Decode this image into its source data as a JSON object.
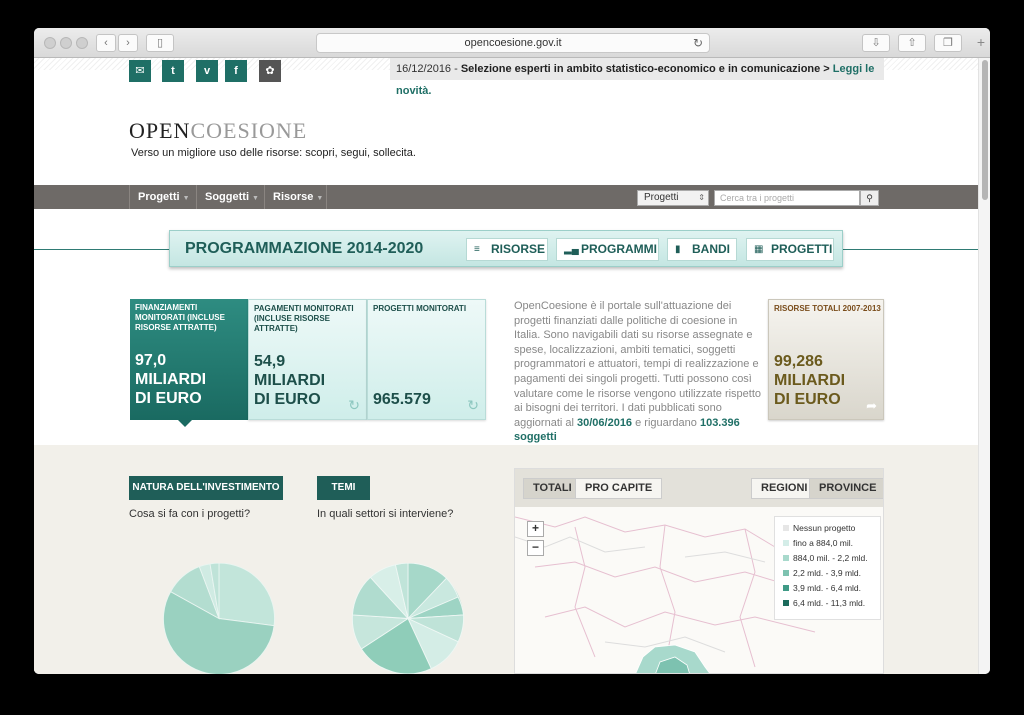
{
  "browser": {
    "url": "opencoesione.gov.it"
  },
  "header": {
    "social_icons": [
      "mail-icon",
      "twitter-icon",
      "vimeo-icon",
      "facebook-icon",
      "award-icon"
    ],
    "notice_date": "16/12/2016 - ",
    "notice_text": "Selezione esperti in ambito statistico-economico e in comunicazione > ",
    "notice_link": "Leggi le novità.",
    "logo_part1": "OPEN",
    "logo_part2": "COESIONE",
    "tagline": "Verso un migliore uso delle risorse: scopri, segui, sollecita."
  },
  "nav": {
    "items": [
      {
        "label": "Progetti"
      },
      {
        "label": "Soggetti"
      },
      {
        "label": "Risorse"
      }
    ],
    "select_value": "Progetti",
    "search_placeholder": "Cerca tra i progetti"
  },
  "programmazione": {
    "title": "PROGRAMMAZIONE 2014-2020",
    "buttons": [
      {
        "label": "RISORSE",
        "icon": "stack-icon"
      },
      {
        "label": "PROGRAMMI",
        "icon": "bar-chart-icon"
      },
      {
        "label": "BANDI",
        "icon": "bookmark-icon"
      },
      {
        "label": "PROGETTI",
        "icon": "document-icon"
      }
    ]
  },
  "stats": {
    "finanziamenti": {
      "label": "FINANZIAMENTI MONITORATI (INCLUSE RISORSE ATTRATTE)",
      "value_lines": [
        "97,0",
        "MILIARDI",
        "DI EURO"
      ]
    },
    "pagamenti": {
      "label": "PAGAMENTI MONITORATI (INCLUSE RISORSE ATTRATTE)",
      "value_lines": [
        "54,9",
        "MILIARDI",
        "DI EURO"
      ]
    },
    "progetti": {
      "label": "PROGETTI MONITORATI",
      "value": "965.579"
    },
    "risorse_totali": {
      "label": "RISORSE TOTALI 2007-2013",
      "value_lines": [
        "99,286",
        "MILIARDI",
        "DI EURO"
      ]
    }
  },
  "description": {
    "text": "OpenCoesione è il portale sull'attuazione dei progetti finanziati dalle politiche di coesione in Italia. Sono navigabili dati su risorse assegnate e spese, localizzazioni, ambiti tematici, soggetti programmatori e attuatori, tempi di realizzazione e pagamenti dei singoli progetti. Tutti possono così valutare come le risorse vengono utilizzate rispetto ai bisogni dei territori. I dati pubblicati sono aggiornati al ",
    "date": "30/06/2016",
    "middle": " e riguardano ",
    "subjects": "103.396 soggetti"
  },
  "natura": {
    "tag": "NATURA DELL'INVESTIMENTO",
    "question": "Cosa si fa con i progetti?"
  },
  "temi": {
    "tag": "TEMI",
    "question": "In quali settori si interviene?"
  },
  "map": {
    "tabs_left": [
      "TOTALI",
      "PRO CAPITE"
    ],
    "tabs_right": [
      "REGIONI",
      "PROVINCE"
    ],
    "zoom_in": "+",
    "zoom_out": "−",
    "legend": [
      {
        "label": "Nessun progetto",
        "color": "#e6e6e6"
      },
      {
        "label": "fino a 884,0 mil.",
        "color": "#d4ede8"
      },
      {
        "label": "884,0 mil. - 2,2 mld.",
        "color": "#a8d9cc"
      },
      {
        "label": "2,2 mld. - 3,9 mld.",
        "color": "#7dc2b0"
      },
      {
        "label": "3,9 mld. - 6,4 mld.",
        "color": "#3f9a86"
      },
      {
        "label": "6,4 mld. - 11,3 mld.",
        "color": "#1c6b5c"
      }
    ]
  },
  "colors": {
    "brand": "#1f5e58",
    "nav": "#6e6a67"
  }
}
